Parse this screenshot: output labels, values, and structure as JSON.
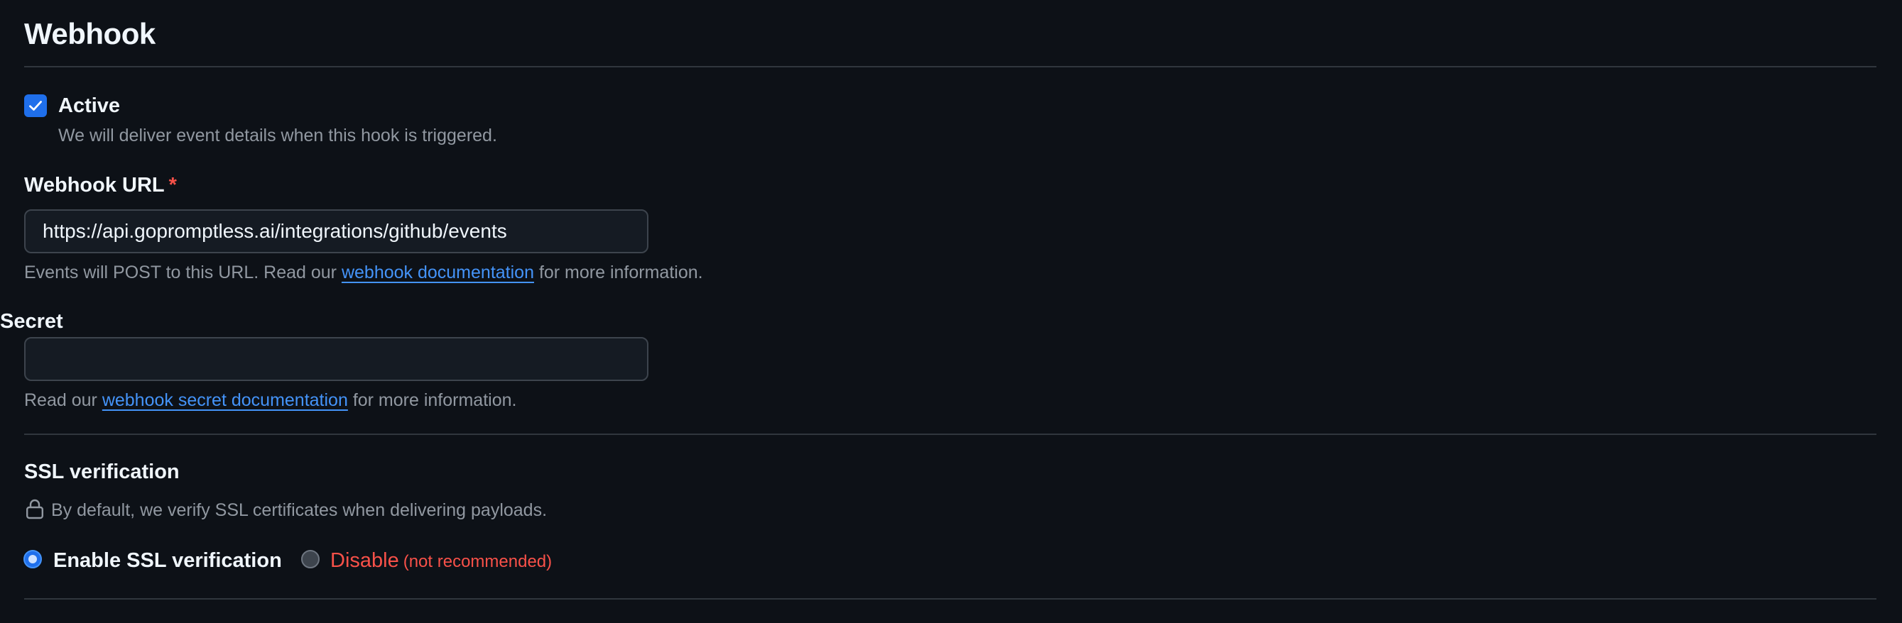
{
  "section": {
    "title": "Webhook"
  },
  "active": {
    "checked": true,
    "label": "Active",
    "description": "We will deliver event details when this hook is triggered."
  },
  "webhook_url": {
    "label": "Webhook URL",
    "required_marker": "*",
    "value": "https://api.gopromptless.ai/integrations/github/events",
    "help_prefix": "Events will POST to this URL. Read our",
    "help_link": "webhook documentation",
    "help_suffix": "for more information."
  },
  "secret": {
    "label": "Secret",
    "value": "",
    "help_prefix": "Read our",
    "help_link": "webhook secret documentation",
    "help_suffix": "for more information."
  },
  "ssl": {
    "title": "SSL verification",
    "icon": "lock-icon",
    "description": "By default, we verify SSL certificates when delivering payloads.",
    "options": [
      {
        "label": "Enable SSL verification",
        "selected": true
      },
      {
        "label": "Disable",
        "note": "(not recommended)",
        "selected": false
      }
    ]
  },
  "colors": {
    "background": "#0d1117",
    "accent": "#1f6feb",
    "link": "#4493f8",
    "danger": "#f85149",
    "muted_text": "#9198a1",
    "border": "#30363d"
  }
}
